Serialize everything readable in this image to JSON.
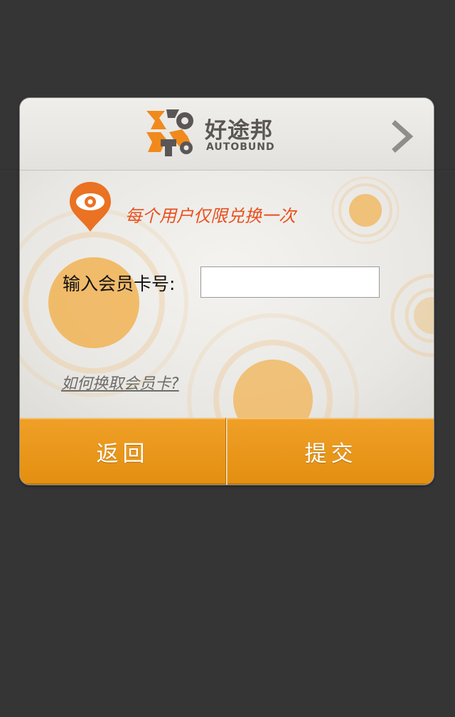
{
  "brand": {
    "name_cn": "好途邦",
    "name_en": "AUTOBUND",
    "logo_icon": "autobund-logo-icon",
    "accent_color": "#f08a1c",
    "text_color": "#5a5656"
  },
  "header": {
    "next_icon": "chevron-right-icon"
  },
  "notice": {
    "icon": "eye-pin-icon",
    "text": "每个用户仅限兑换一次",
    "color": "#e8501e"
  },
  "form": {
    "card_label": "输入会员卡号:",
    "card_value": "",
    "card_placeholder": "",
    "help_link": "如何换取会员卡?"
  },
  "buttons": {
    "back_label": "返回",
    "submit_label": "提交",
    "color": "#eb9a1e"
  }
}
